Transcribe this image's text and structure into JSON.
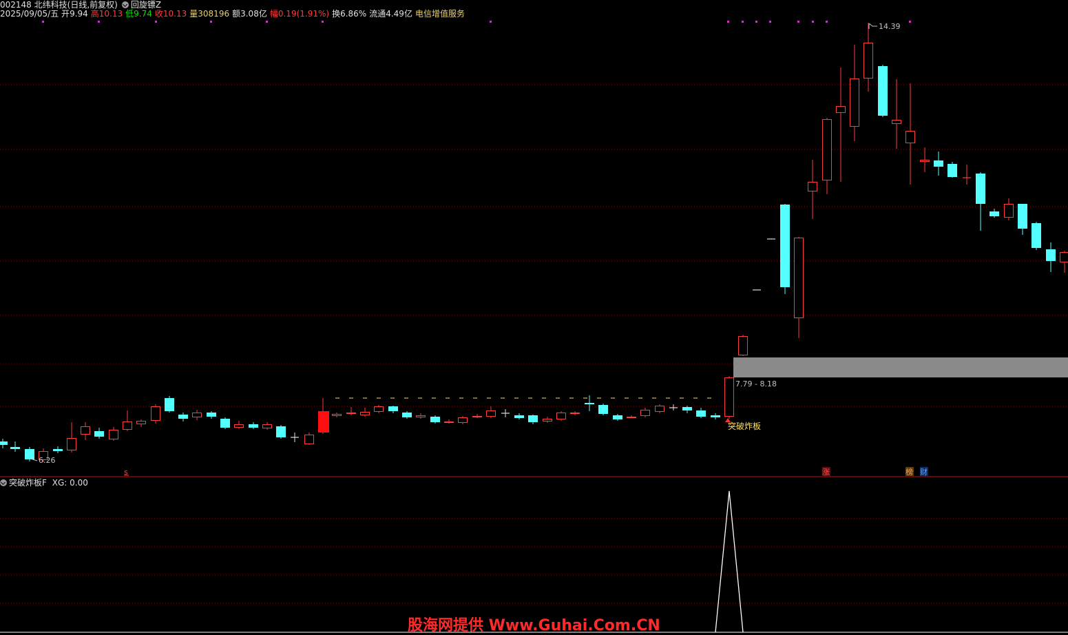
{
  "header": {
    "code": "002148",
    "name": "北纬科技",
    "period": "(日线,前复权)",
    "tool": "回旋镖Z",
    "date": "2025/09/05/五",
    "open_label": "开",
    "open": "9.94",
    "high_label": "高",
    "high": "10.13",
    "low_label": "低",
    "low": "9.74",
    "close_label": "收",
    "close": "10.13",
    "vol_label": "量",
    "vol": "308196",
    "amount_label": "额",
    "amount": "3.08亿",
    "change_label": "幅",
    "change": "0.19(1.91%)",
    "turnover_label": "换",
    "turnover": "6.86%",
    "float_label": "流通",
    "float": "4.49亿",
    "sector": "电信增值服务"
  },
  "annotations": {
    "high_marker": "14.39",
    "low_marker": "6.26",
    "zone_label": "7.79 - 8.18",
    "breakout_label": "突破炸板",
    "s_marker": "s",
    "zhang_marker": "涨",
    "bang_marker": "榜",
    "cai_marker": "财"
  },
  "indicator": {
    "name": "突破炸板F",
    "xg_label": "XG:",
    "xg_value": "0.00"
  },
  "watermark": "股海网提供 Www.Guhai.Com.CN",
  "colors": {
    "up": "#ff3c3c",
    "down": "#54ffff",
    "grid": "#8b0000",
    "signal": "#ffffff",
    "zone": "#8a8a8a",
    "marker": "#cc33cc"
  }
}
